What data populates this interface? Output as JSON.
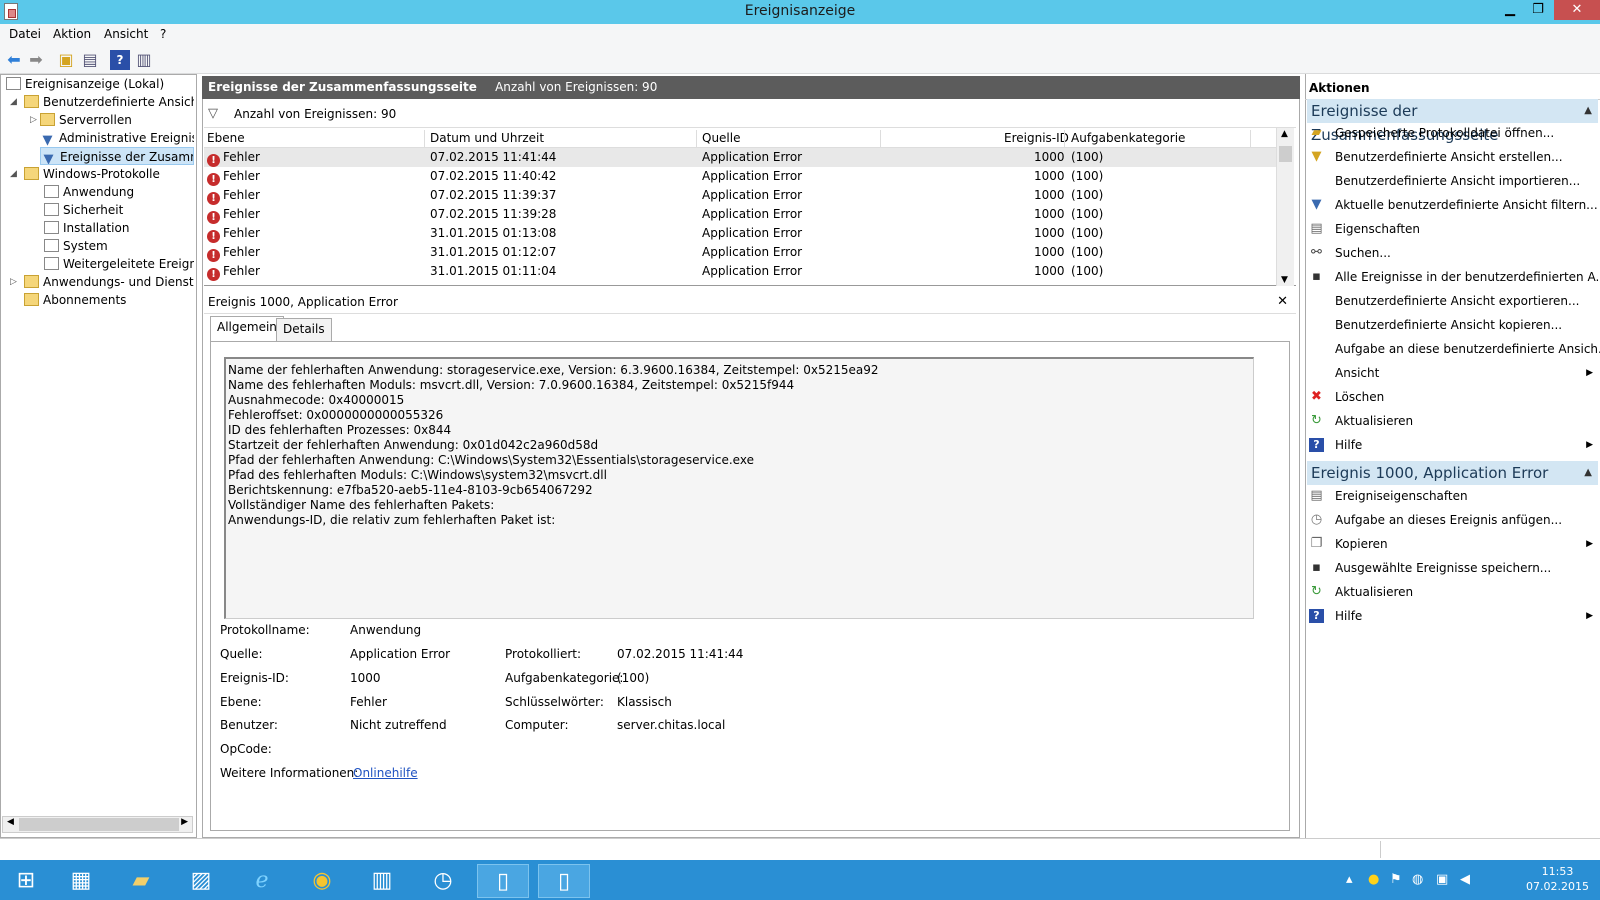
{
  "window": {
    "title": "Ereignisanzeige",
    "min": "▁",
    "max": "❐",
    "close": "✕"
  },
  "menu": [
    "Datei",
    "Aktion",
    "Ansicht",
    "?"
  ],
  "tree": {
    "root": "Ereignisanzeige (Lokal)",
    "custom_views": "Benutzerdefinierte Ansichter",
    "server_roles": "Serverrollen",
    "admin_events": "Administrative Ereignisse",
    "summary_events": "Ereignisse der Zusammer",
    "windows_logs": "Windows-Protokolle",
    "application": "Anwendung",
    "security": "Sicherheit",
    "setup": "Installation",
    "system": "System",
    "forwarded": "Weitergeleitete Ereignisse",
    "app_services": "Anwendungs- und Dienstpro",
    "subscriptions": "Abonnements"
  },
  "center": {
    "title": "Ereignisse der Zusammenfassungsseite",
    "count_label": "Anzahl von Ereignissen: 90",
    "filter_label": "Anzahl von Ereignissen: 90",
    "columns": [
      "Ebene",
      "Datum und Uhrzeit",
      "Quelle",
      "Ereignis-ID",
      "Aufgabenkategorie"
    ],
    "rows": [
      {
        "level": "Fehler",
        "date": "07.02.2015 11:41:44",
        "source": "Application Error",
        "id": "1000",
        "cat": "(100)"
      },
      {
        "level": "Fehler",
        "date": "07.02.2015 11:40:42",
        "source": "Application Error",
        "id": "1000",
        "cat": "(100)"
      },
      {
        "level": "Fehler",
        "date": "07.02.2015 11:39:37",
        "source": "Application Error",
        "id": "1000",
        "cat": "(100)"
      },
      {
        "level": "Fehler",
        "date": "07.02.2015 11:39:28",
        "source": "Application Error",
        "id": "1000",
        "cat": "(100)"
      },
      {
        "level": "Fehler",
        "date": "31.01.2015 01:13:08",
        "source": "Application Error",
        "id": "1000",
        "cat": "(100)"
      },
      {
        "level": "Fehler",
        "date": "31.01.2015 01:12:07",
        "source": "Application Error",
        "id": "1000",
        "cat": "(100)"
      },
      {
        "level": "Fehler",
        "date": "31.01.2015 01:11:04",
        "source": "Application Error",
        "id": "1000",
        "cat": "(100)"
      }
    ]
  },
  "detail": {
    "title": "Ereignis 1000, Application Error",
    "tabs": [
      "Allgemein",
      "Details"
    ],
    "description": [
      "Name der fehlerhaften Anwendung: storageservice.exe, Version: 6.3.9600.16384, Zeitstempel: 0x5215ea92",
      "Name des fehlerhaften Moduls: msvcrt.dll, Version: 7.0.9600.16384, Zeitstempel: 0x5215f944",
      "Ausnahmecode: 0x40000015",
      "Fehleroffset: 0x0000000000055326",
      "ID des fehlerhaften Prozesses: 0x844",
      "Startzeit der fehlerhaften Anwendung: 0x01d042c2a960d58d",
      "Pfad der fehlerhaften Anwendung: C:\\Windows\\System32\\Essentials\\storageservice.exe",
      "Pfad des fehlerhaften Moduls: C:\\Windows\\system32\\msvcrt.dll",
      "Berichtskennung: e7fba520-aeb5-11e4-8103-9cb654067292",
      "Vollständiger Name des fehlerhaften Pakets:",
      "Anwendungs-ID, die relativ zum fehlerhaften Paket ist:"
    ],
    "fields": {
      "log_name_label": "Protokollname:",
      "log_name": "Anwendung",
      "source_label": "Quelle:",
      "source": "Application Error",
      "logged_label": "Protokolliert:",
      "logged": "07.02.2015 11:41:44",
      "event_id_label": "Ereignis-ID:",
      "event_id": "1000",
      "task_label": "Aufgabenkategorie:",
      "task": "(100)",
      "level_label": "Ebene:",
      "level": "Fehler",
      "keywords_label": "Schlüsselwörter:",
      "keywords": "Klassisch",
      "user_label": "Benutzer:",
      "user": "Nicht zutreffend",
      "computer_label": "Computer:",
      "computer": "server.chitas.local",
      "opcode_label": "OpCode:",
      "more_label": "Weitere Informationen:",
      "more_link": "Onlinehilfe"
    }
  },
  "actions": {
    "title": "Aktionen",
    "section1": "Ereignisse der Zusammenfassungsseite",
    "items1": [
      "Gespeicherte Protokolldatei öffnen...",
      "Benutzerdefinierte Ansicht erstellen...",
      "Benutzerdefinierte Ansicht importieren...",
      "Aktuelle benutzerdefinierte Ansicht filtern...",
      "Eigenschaften",
      "Suchen...",
      "Alle Ereignisse in der benutzerdefinierten A...",
      "Benutzerdefinierte Ansicht exportieren...",
      "Benutzerdefinierte Ansicht kopieren...",
      "Aufgabe an diese benutzerdefinierte Ansich...",
      "Ansicht",
      "Löschen",
      "Aktualisieren",
      "Hilfe"
    ],
    "section2": "Ereignis 1000, Application Error",
    "items2": [
      "Ereigniseigenschaften",
      "Aufgabe an dieses Ereignis anfügen...",
      "Kopieren",
      "Ausgewählte Ereignisse speichern...",
      "Aktualisieren",
      "Hilfe"
    ]
  },
  "taskbar": {
    "time": "11:53",
    "date": "07.02.2015"
  },
  "colors": {
    "titlebar": "#5ac8ea",
    "taskbar": "#2a8fd4",
    "section": "#d3e6f3",
    "error": "#c62c2c",
    "link": "#1f52c1"
  }
}
